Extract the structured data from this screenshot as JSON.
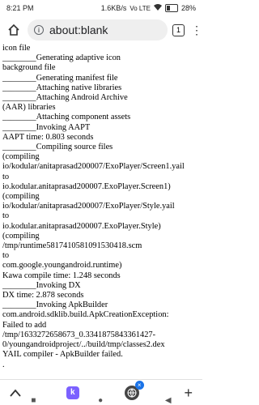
{
  "status": {
    "time": "8:21 PM",
    "net_speed": "1.6KB/s",
    "battery": "28%",
    "signal": "Vo LTE"
  },
  "toolbar": {
    "url": "about:blank",
    "tab_count": "1",
    "home_icon": "home-icon",
    "menu_icon": "more-vert-icon",
    "info_icon": "info-icon"
  },
  "log": {
    "lines": [
      "icon file",
      "________Generating adaptive icon",
      "background file",
      "________Generating manifest file",
      "________Attaching native libraries",
      "________Attaching Android Archive",
      "(AAR) libraries",
      "________Attaching component assets",
      "________Invoking AAPT",
      "AAPT time: 0.803 seconds",
      "________Compiling source files",
      "(compiling",
      "io/kodular/anitaprasad200007/ExoPlayer/Screen1.yail",
      "to",
      "io.kodular.anitaprasad200007.ExoPlayer.Screen1)",
      "(compiling",
      "io/kodular/anitaprasad200007/ExoPlayer/Style.yail",
      "to",
      "io.kodular.anitaprasad200007.ExoPlayer.Style)",
      "(compiling",
      "/tmp/runtime5817410581091530418.scm",
      "to",
      "com.google.youngandroid.runtime)",
      "Kawa compile time: 1.248 seconds",
      "________Invoking DX",
      "DX time: 2.878 seconds",
      "________Invoking ApkBuilder",
      "com.android.sdklib.build.ApkCreationException:",
      "Failed to add",
      "/tmp/1633272658673_0.3341875843361427-",
      "0/youngandroidproject/../build/tmp/classes2.dex",
      "YAIL compiler - ApkBuilder failed.",
      "."
    ]
  },
  "bottom": {
    "back_icon": "chevron-up-icon",
    "k_app_label": "k",
    "tab_icon": "globe-icon",
    "close_icon": "close-icon",
    "new_tab_icon": "plus-icon"
  }
}
